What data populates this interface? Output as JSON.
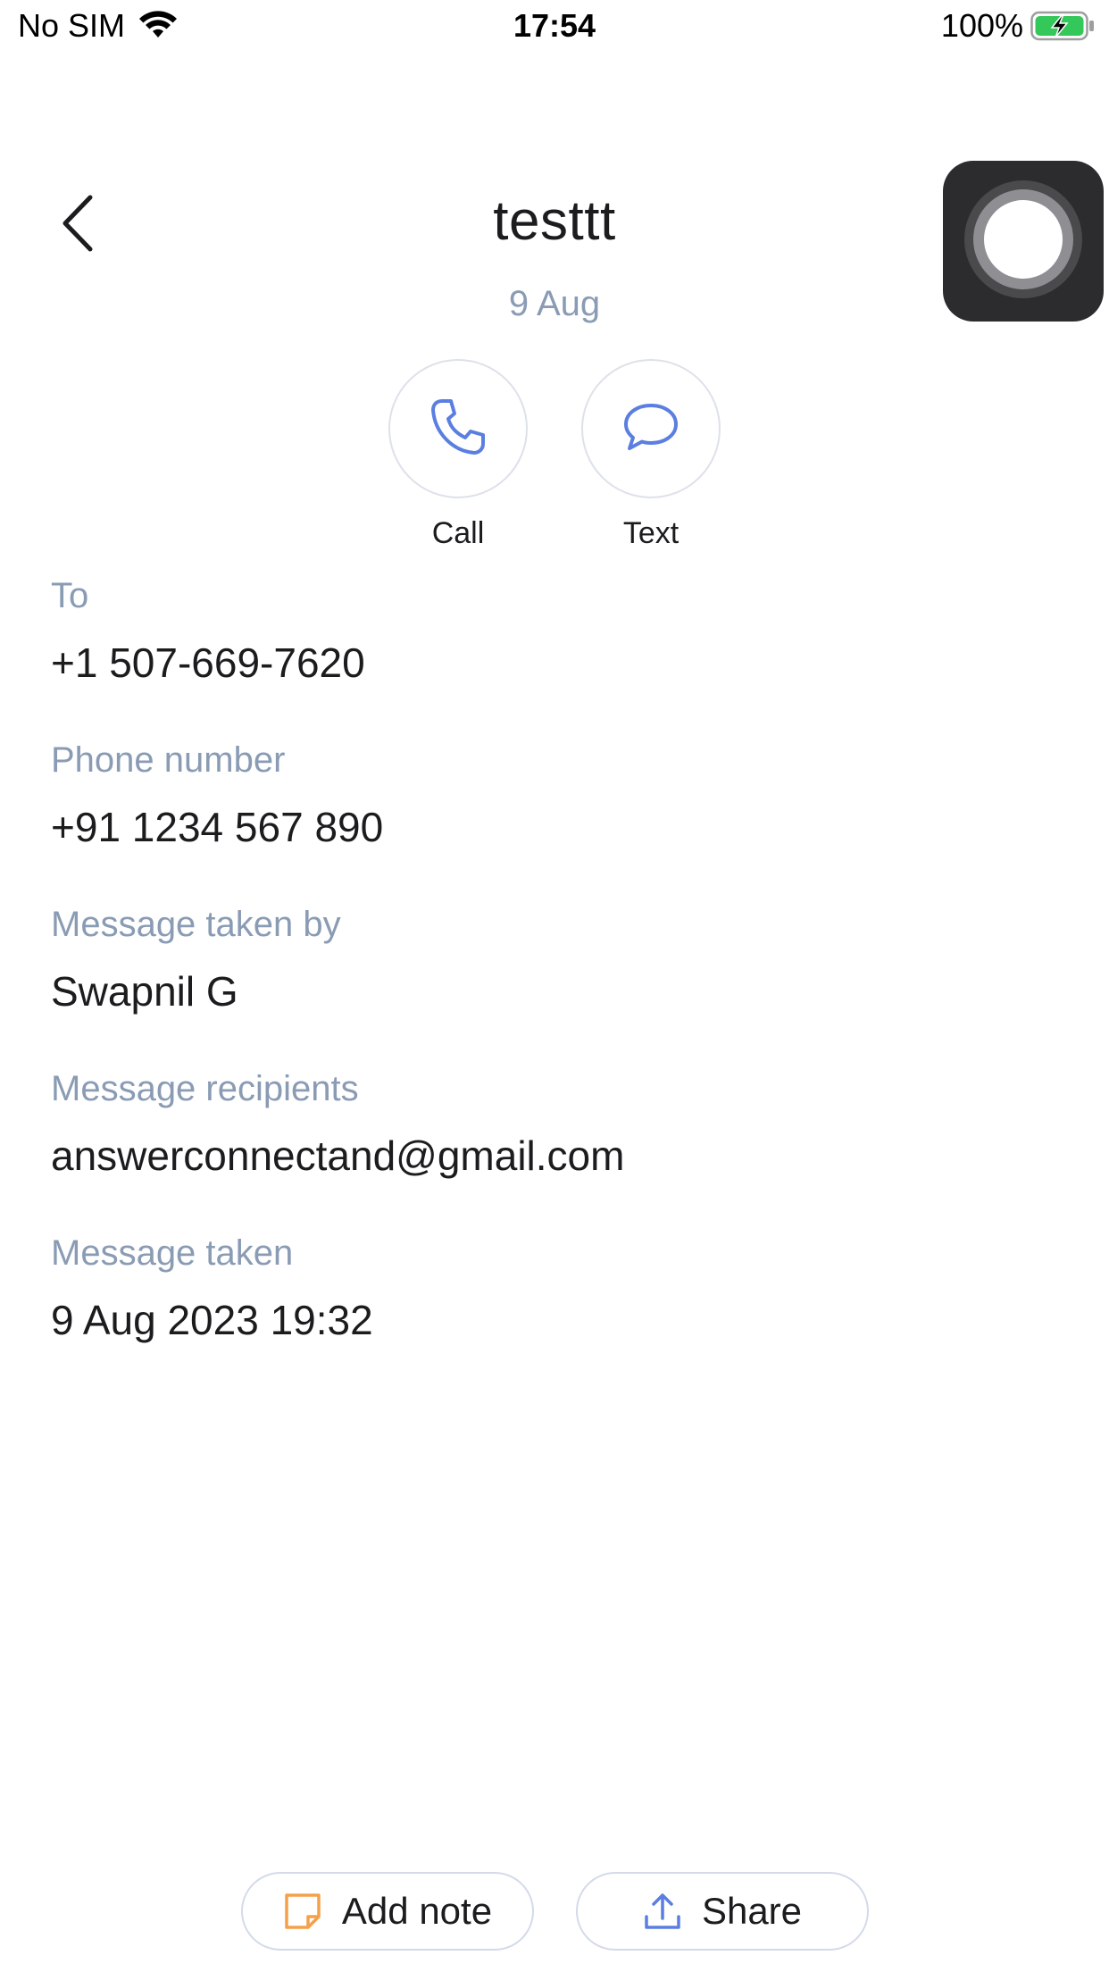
{
  "status_bar": {
    "carrier": "No SIM",
    "time": "17:54",
    "battery": "100%"
  },
  "header": {
    "title": "testtt",
    "date": "9 Aug"
  },
  "actions": {
    "call": "Call",
    "text": "Text"
  },
  "fields": [
    {
      "label": "To",
      "value": "+1 507-669-7620"
    },
    {
      "label": "Phone number",
      "value": "+91 1234 567 890"
    },
    {
      "label": "Message taken by",
      "value": "Swapnil G"
    },
    {
      "label": "Message recipients",
      "value": "answerconnectand@gmail.com"
    },
    {
      "label": "Message taken",
      "value": "9 Aug 2023 19:32"
    }
  ],
  "bottom": {
    "add_note": "Add note",
    "share": "Share"
  },
  "colors": {
    "accent": "#5b7fe0",
    "label": "#8a9bb4",
    "note_icon": "#f5a04a"
  }
}
